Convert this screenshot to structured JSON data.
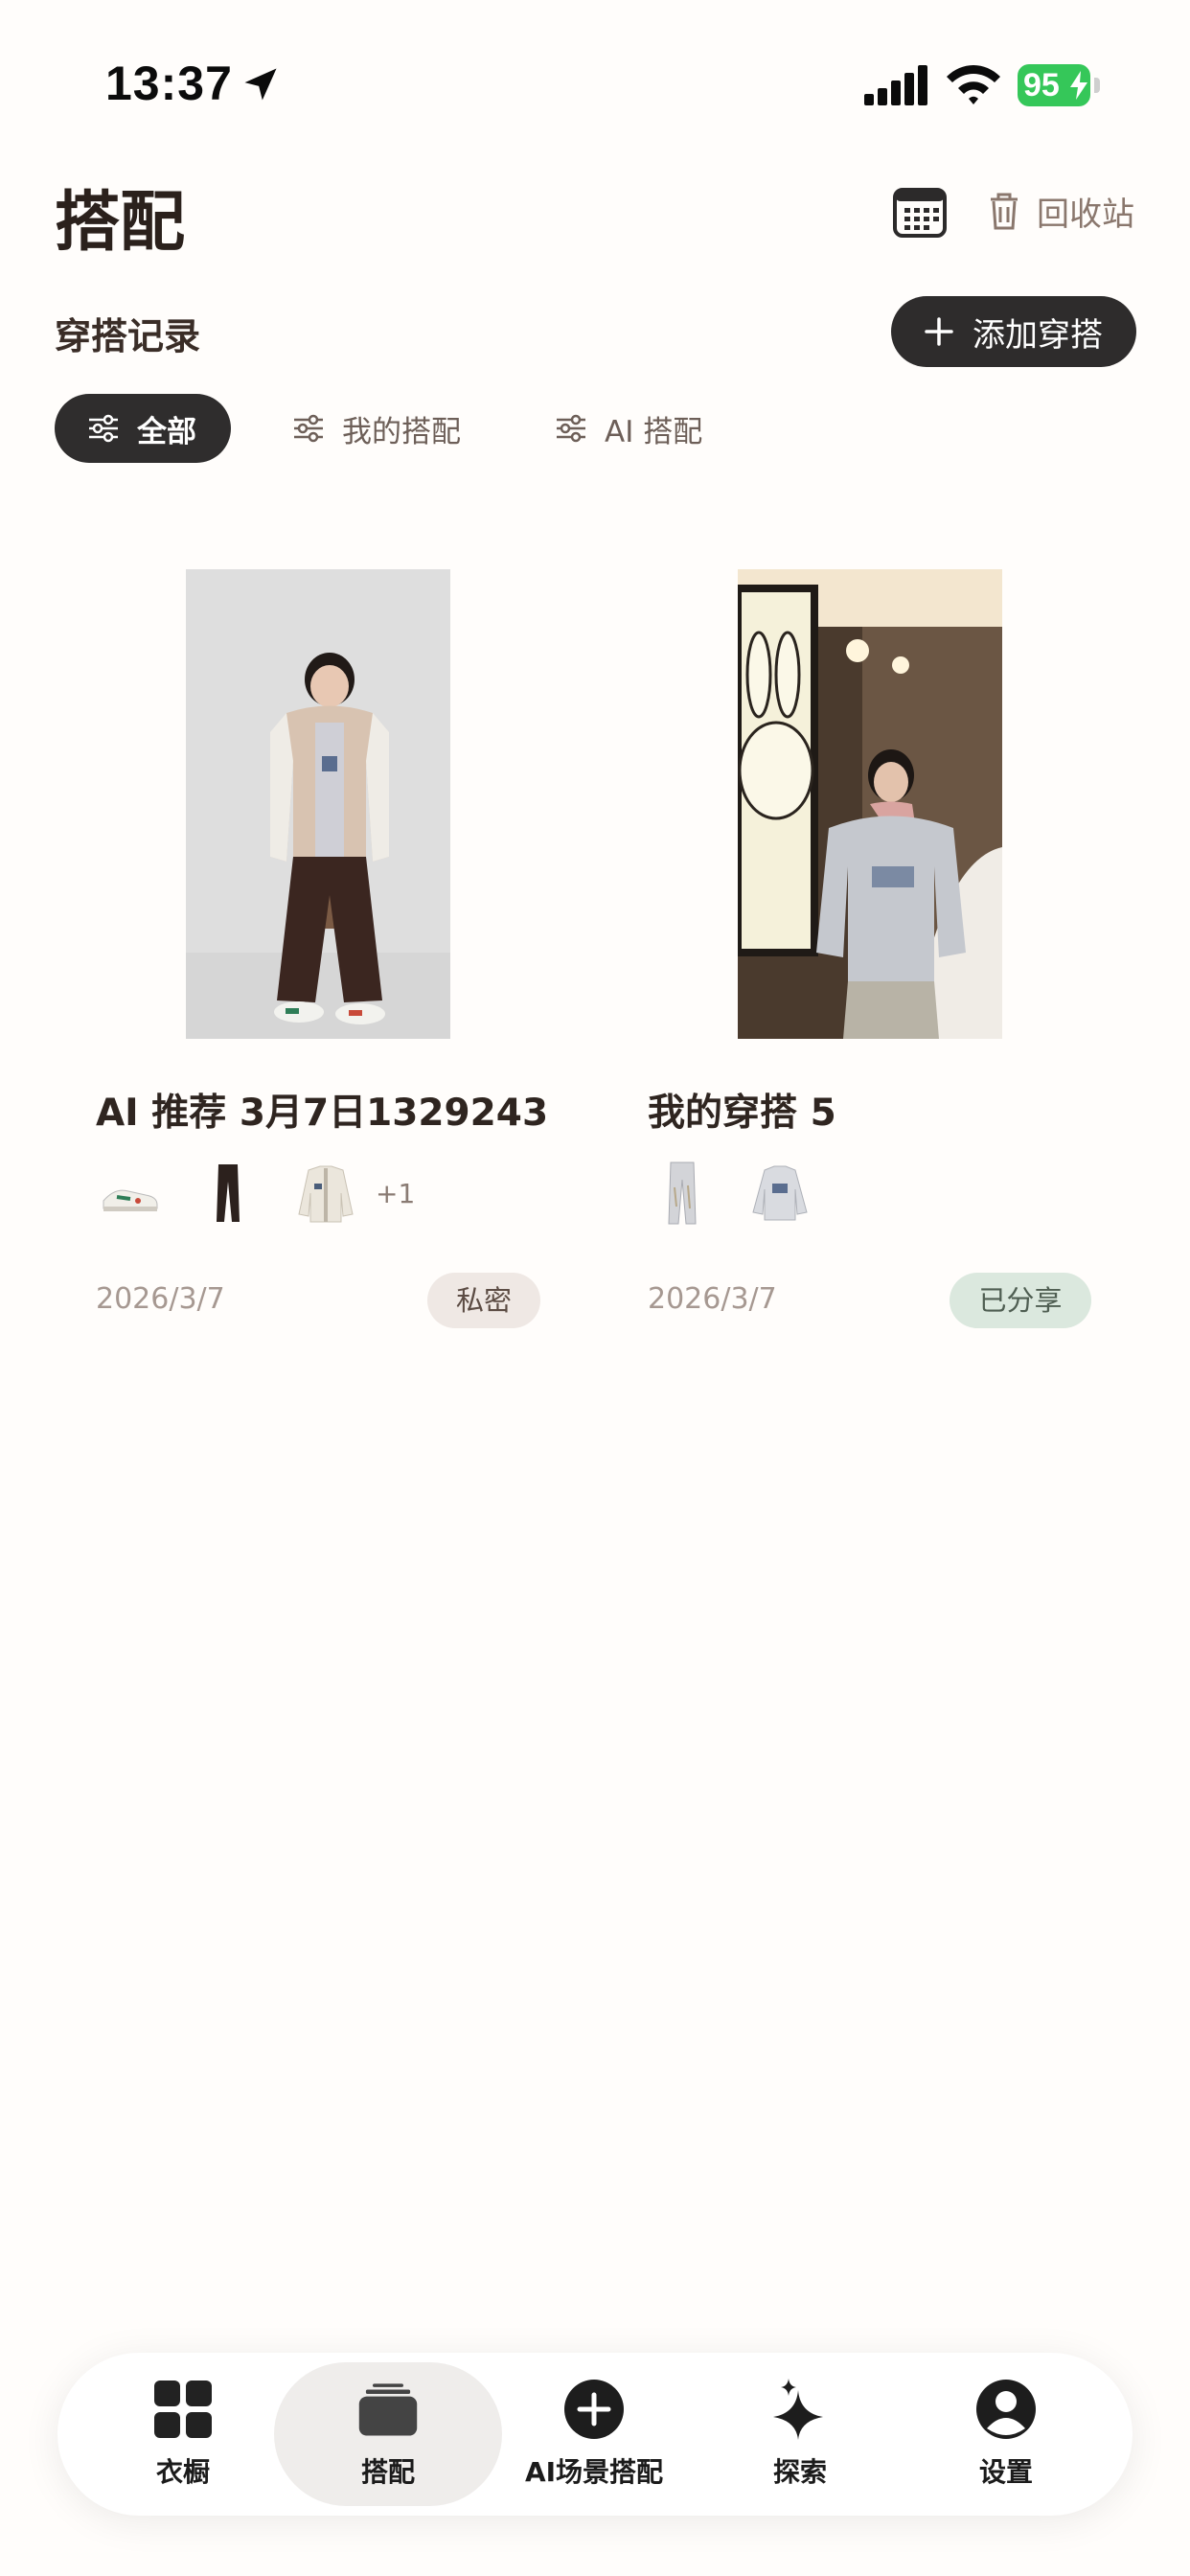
{
  "status_bar": {
    "time": "13:37",
    "battery": "95"
  },
  "header": {
    "title": "搭配",
    "recycle_label": "回收站"
  },
  "section": {
    "title": "穿搭记录",
    "add_button_label": "添加穿搭"
  },
  "filters": [
    {
      "label": "全部",
      "active": true
    },
    {
      "label": "我的搭配",
      "active": false
    },
    {
      "label": "AI 搭配",
      "active": false
    }
  ],
  "outfits": [
    {
      "title": "AI 推荐 3月7日1329243",
      "items": [
        "sneaker-thumbnail",
        "trousers-thumbnail",
        "jacket-thumbnail"
      ],
      "more": "+1",
      "date": "2026/3/7",
      "badge": "私密"
    },
    {
      "title": "我的穿搭 5",
      "items": [
        "jeans-thumbnail",
        "sweatshirt-thumbnail"
      ],
      "date": "2026/3/7",
      "badge": "已分享"
    }
  ],
  "bottom_nav": [
    {
      "label": "衣橱",
      "icon": "grid-icon"
    },
    {
      "label": "搭配",
      "icon": "stack-icon",
      "active": true
    },
    {
      "label": "AI场景搭配",
      "icon": "plus-circle-icon"
    },
    {
      "label": "探索",
      "icon": "sparkle-icon"
    },
    {
      "label": "设置",
      "icon": "profile-icon"
    }
  ],
  "colors": {
    "background": "#fffdfb",
    "dark_button": "#2e2c2c",
    "battery_green": "#35c759",
    "private_badge_bg": "#efe8e4",
    "shared_badge_bg": "#dbe8de"
  }
}
